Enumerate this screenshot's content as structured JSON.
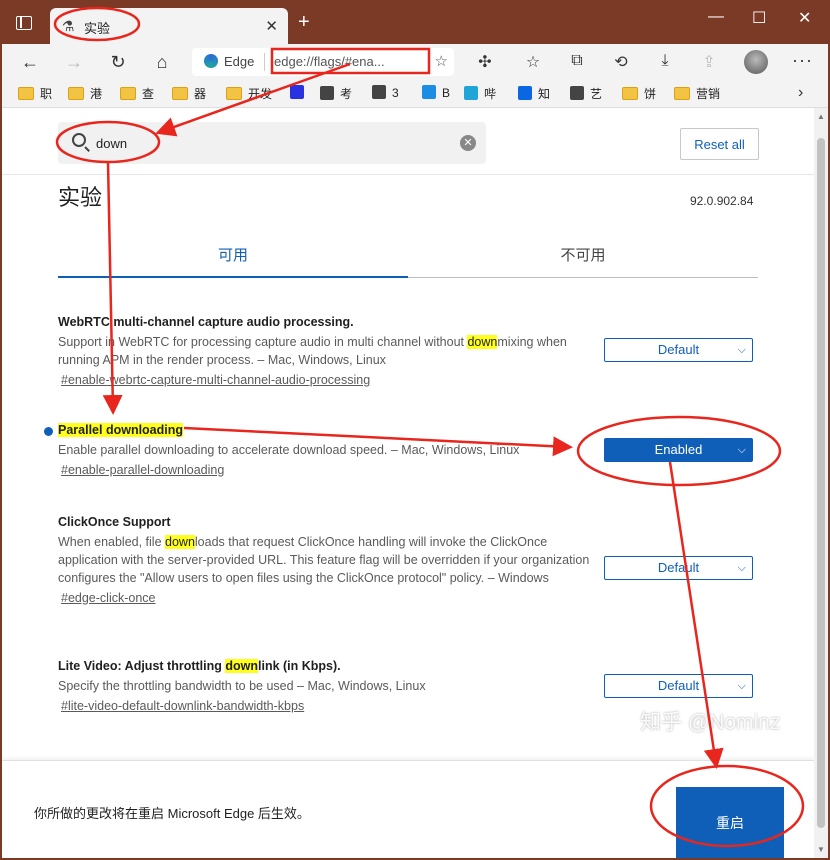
{
  "browser": {
    "tab_title": "实验",
    "tab_favicon": "flask-icon",
    "new_tab": "+",
    "window_controls": {
      "minimize": "—",
      "maximize": "☐",
      "close": "✕"
    }
  },
  "toolbar": {
    "site_label": "Edge",
    "url": "edge://flags/#ena..."
  },
  "bookmarks": [
    {
      "label": "职",
      "icon": "folder-icon"
    },
    {
      "label": "港",
      "icon": "folder-icon"
    },
    {
      "label": "查",
      "icon": "folder-icon"
    },
    {
      "label": "器",
      "icon": "folder-icon"
    },
    {
      "label": "开发",
      "icon": "folder-icon"
    },
    {
      "label": "",
      "icon": "baidu-paw-icon"
    },
    {
      "label": "考",
      "icon": "site-icon"
    },
    {
      "label": "3",
      "icon": "site-icon"
    },
    {
      "label": "B",
      "icon": "bing-icon"
    },
    {
      "label": "哔",
      "icon": "bilibili-icon"
    },
    {
      "label": "知",
      "icon": "zhihu-icon"
    },
    {
      "label": "艺",
      "icon": "site-icon"
    },
    {
      "label": "饼",
      "icon": "folder-icon"
    },
    {
      "label": "营销",
      "icon": "folder-icon"
    }
  ],
  "flags_page": {
    "search_value": "down",
    "reset_label": "Reset all",
    "title": "实验",
    "version": "92.0.902.84",
    "tab_available": "可用",
    "tab_unavailable": "不可用",
    "flags": [
      {
        "title": "WebRTC multi-channel capture audio processing.",
        "desc_before": "Support in WebRTC for processing capture audio in multi channel without ",
        "desc_highlight": "down",
        "desc_after": "mixing when running APM in the render process. – Mac, Windows, Linux",
        "link": "#enable-webrtc-capture-multi-channel-audio-processing",
        "value": "Default"
      },
      {
        "title": "Parallel downloading",
        "desc_before": "Enable parallel downloading to accelerate download speed. – Mac, Windows, Linux",
        "desc_highlight": "",
        "desc_after": "",
        "link": "#enable-parallel-downloading",
        "value": "Enabled"
      },
      {
        "title": "ClickOnce Support",
        "desc_before": "When enabled, file ",
        "desc_highlight": "down",
        "desc_after": "loads that request ClickOnce handling will invoke the ClickOnce application with the server-provided URL. This feature flag will be overridden if your organization configures the \"Allow users to open files using the ClickOnce protocol\" policy. – Windows",
        "link": "#edge-click-once",
        "value": "Default"
      },
      {
        "title_before": "Lite Video: Adjust throttling ",
        "title_highlight": "down",
        "title_after": "link (in Kbps).",
        "desc_before": "Specify the throttling bandwidth to be used – Mac, Windows, Linux",
        "desc_highlight": "",
        "desc_after": "",
        "link": "#lite-video-default-downlink-bandwidth-kbps",
        "value": "Default"
      }
    ],
    "footer_message": "你所做的更改将在重启 Microsoft Edge 后生效。",
    "restart_label": "重启"
  },
  "watermark": "知乎 @Nominz",
  "colors": {
    "titlebar": "#7a3a26",
    "accent": "#0f5fb8",
    "highlight": "#ffff1a",
    "annotation": "#e8261d"
  }
}
